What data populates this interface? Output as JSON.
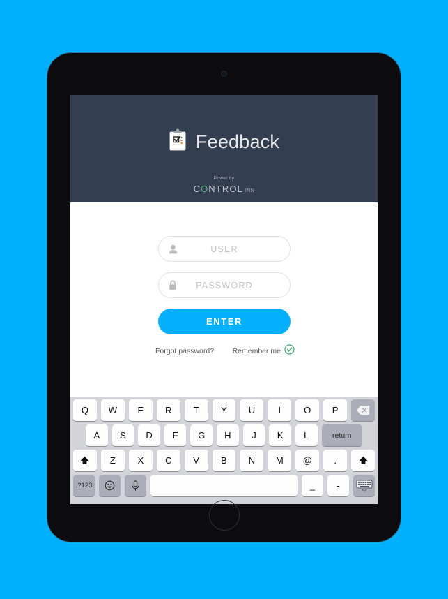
{
  "theme": {
    "page_background": "#00b0fc",
    "header_background": "#343e51",
    "accent_blue": "#04b0fb",
    "accent_green": "#55b07f",
    "keyboard_background": "#d2d4da"
  },
  "device": {
    "name": "tablet-device",
    "camera": "front-camera",
    "home_button": "home-button"
  },
  "app": {
    "title": "Feedback",
    "logo_icon": "clipboard-check-icon",
    "powered_by_label": "Power by",
    "powered_by_brand": "CONTROL",
    "powered_by_brand_prefix": "C",
    "powered_by_brand_mark": "O",
    "powered_by_brand_rest": "NTROL",
    "powered_by_suffix": "INN"
  },
  "login": {
    "user_field": {
      "icon": "user-icon",
      "placeholder": "USER",
      "value": ""
    },
    "password_field": {
      "icon": "lock-icon",
      "placeholder": "PASSWORD",
      "value": ""
    },
    "enter_label": "ENTER",
    "forgot_label": "Forgot password?",
    "remember_label": "Remember me",
    "remember_icon": "check-circle-icon",
    "remember_checked": true
  },
  "keyboard": {
    "row1": [
      {
        "label": "Q",
        "name": "key-q",
        "style": "light"
      },
      {
        "label": "W",
        "name": "key-w",
        "style": "light"
      },
      {
        "label": "E",
        "name": "key-e",
        "style": "light"
      },
      {
        "label": "R",
        "name": "key-r",
        "style": "light"
      },
      {
        "label": "T",
        "name": "key-t",
        "style": "light"
      },
      {
        "label": "Y",
        "name": "key-y",
        "style": "light"
      },
      {
        "label": "U",
        "name": "key-u",
        "style": "light"
      },
      {
        "label": "I",
        "name": "key-i",
        "style": "light"
      },
      {
        "label": "O",
        "name": "key-o",
        "style": "light"
      },
      {
        "label": "P",
        "name": "key-p",
        "style": "light"
      },
      {
        "label": "",
        "name": "key-backspace",
        "style": "dark",
        "icon": "backspace-icon"
      }
    ],
    "row2": [
      {
        "label": "A",
        "name": "key-a",
        "style": "light"
      },
      {
        "label": "S",
        "name": "key-s",
        "style": "light"
      },
      {
        "label": "D",
        "name": "key-d",
        "style": "light"
      },
      {
        "label": "F",
        "name": "key-f",
        "style": "light"
      },
      {
        "label": "G",
        "name": "key-g",
        "style": "light"
      },
      {
        "label": "H",
        "name": "key-h",
        "style": "light"
      },
      {
        "label": "J",
        "name": "key-j",
        "style": "light"
      },
      {
        "label": "K",
        "name": "key-k",
        "style": "light"
      },
      {
        "label": "L",
        "name": "key-l",
        "style": "light"
      },
      {
        "label": "return",
        "name": "key-return",
        "style": "dark"
      }
    ],
    "row3": [
      {
        "label": "",
        "name": "key-shift-left",
        "style": "light",
        "icon": "shift-icon"
      },
      {
        "label": "Z",
        "name": "key-z",
        "style": "light"
      },
      {
        "label": "X",
        "name": "key-x",
        "style": "light"
      },
      {
        "label": "C",
        "name": "key-c",
        "style": "light"
      },
      {
        "label": "V",
        "name": "key-v",
        "style": "light"
      },
      {
        "label": "B",
        "name": "key-b",
        "style": "light"
      },
      {
        "label": "N",
        "name": "key-n",
        "style": "light"
      },
      {
        "label": "M",
        "name": "key-m",
        "style": "light"
      },
      {
        "label": "@",
        "name": "key-at",
        "style": "light"
      },
      {
        "label": ".",
        "name": "key-period",
        "style": "light"
      },
      {
        "label": "",
        "name": "key-shift-right",
        "style": "light",
        "icon": "shift-icon"
      }
    ],
    "row4": [
      {
        "label": ".?123",
        "name": "key-numbers-left",
        "style": "dark"
      },
      {
        "label": "",
        "name": "key-emoji",
        "style": "dark",
        "icon": "emoji-icon"
      },
      {
        "label": "",
        "name": "key-microphone",
        "style": "dark",
        "icon": "microphone-icon"
      },
      {
        "label": "",
        "name": "key-space",
        "style": "light"
      },
      {
        "label": "_",
        "name": "key-underscore",
        "style": "light"
      },
      {
        "label": "-",
        "name": "key-hyphen",
        "style": "light"
      },
      {
        "label": "",
        "name": "key-hide-keyboard",
        "style": "dark",
        "icon": "hide-keyboard-icon"
      }
    ]
  }
}
